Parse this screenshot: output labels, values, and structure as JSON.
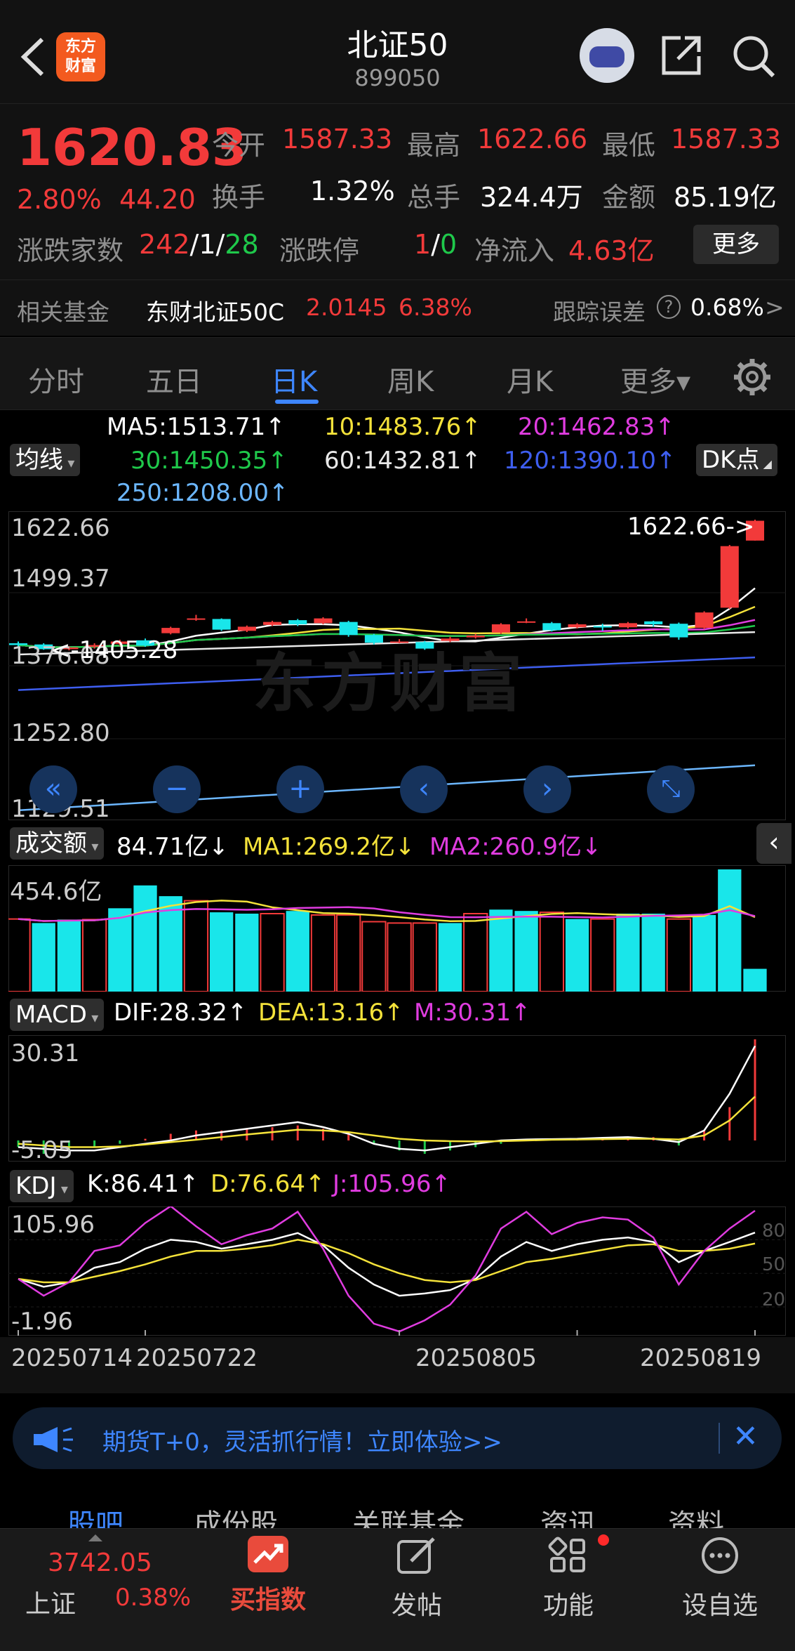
{
  "header": {
    "title": "北证50",
    "code": "899050",
    "logo_lines": [
      "东方",
      "财富"
    ]
  },
  "quote": {
    "price": "1620.83",
    "change_pct": "2.80%",
    "change": "44.20",
    "open_label": "今开",
    "open": "1587.33",
    "high_label": "最高",
    "high": "1622.66",
    "low_label": "最低",
    "low": "1587.33",
    "turnover_label": "换手",
    "turnover": "1.32%",
    "volume_label": "总手",
    "volume": "324.4万",
    "amount_label": "金额",
    "amount": "85.19亿",
    "breadth_label": "涨跌家数",
    "breadth_up": "242",
    "breadth_sep1": "/",
    "breadth_flat": "1",
    "breadth_sep2": "/",
    "breadth_down": "28",
    "limit_label": "涨跌停",
    "limit_up": "1",
    "limit_sep": "/",
    "limit_down": "0",
    "netflow_label": "净流入",
    "netflow": "4.63亿",
    "more_label": "更多"
  },
  "fund": {
    "label": "相关基金",
    "name": "东财北证50C",
    "nav": "2.0145",
    "pct": "6.38%",
    "tracking_label": "跟踪误差",
    "tracking": "0.68%",
    "help_icon": "?",
    "arrow": ">"
  },
  "tabs": [
    "分时",
    "五日",
    "日K",
    "周K",
    "月K",
    "更多▾"
  ],
  "active_tab": 2,
  "ma_legend": {
    "chip": "均线",
    "ma5": "MA5:1513.71↑",
    "ma10": "10:1483.76↑",
    "ma20": "20:1462.83↑",
    "ma30": "30:1450.35↑",
    "ma60": "60:1432.81↑",
    "ma120": "120:1390.10↑",
    "ma250": "250:1208.00↑",
    "dk_chip": "DK点"
  },
  "price_axis": [
    "1622.66",
    "1499.37",
    "1376.08",
    "1252.80",
    "1129.51"
  ],
  "high_marker": "1622.66->",
  "low_marker": "<-1405.28",
  "watermark": "东方财富",
  "volume_legend": {
    "chip": "成交额",
    "value": "84.71亿↓",
    "ma1": "MA1:269.2亿↓",
    "ma2": "MA2:260.9亿↓",
    "axis": "454.6亿"
  },
  "macd_legend": {
    "chip": "MACD",
    "dif": "DIF:28.32↑",
    "dea": "DEA:13.16↑",
    "m": "M:30.31↑",
    "axis_top": "30.31",
    "axis_bottom": "-5.05"
  },
  "kdj_legend": {
    "chip": "KDJ",
    "k": "K:86.41↑",
    "d": "D:76.64↑",
    "j": "J:105.96↑",
    "axis_top": "105.96",
    "axis_bottom": "-1.96",
    "levels": [
      "80",
      "50",
      "20"
    ]
  },
  "dates": [
    "20250714",
    "20250722",
    "20250805",
    "20250819"
  ],
  "chart_data": {
    "type": "candlestick",
    "candles": [
      {
        "o": 1414,
        "c": 1411,
        "h": 1417,
        "l": 1408
      },
      {
        "o": 1412,
        "c": 1404,
        "h": 1414,
        "l": 1403
      },
      {
        "o": 1404,
        "c": 1407,
        "h": 1409,
        "l": 1402
      },
      {
        "o": 1408,
        "c": 1411,
        "h": 1414,
        "l": 1405
      },
      {
        "o": 1413,
        "c": 1417,
        "h": 1420,
        "l": 1410
      },
      {
        "o": 1419,
        "c": 1410,
        "h": 1422,
        "l": 1408
      },
      {
        "o": 1431,
        "c": 1440,
        "h": 1442,
        "l": 1429
      },
      {
        "o": 1455,
        "c": 1456,
        "h": 1462,
        "l": 1452
      },
      {
        "o": 1455,
        "c": 1437,
        "h": 1456,
        "l": 1435
      },
      {
        "o": 1435,
        "c": 1442,
        "h": 1444,
        "l": 1433
      },
      {
        "o": 1445,
        "c": 1450,
        "h": 1452,
        "l": 1443
      },
      {
        "o": 1453,
        "c": 1446,
        "h": 1455,
        "l": 1443
      },
      {
        "o": 1448,
        "c": 1456,
        "h": 1458,
        "l": 1446
      },
      {
        "o": 1450,
        "c": 1428,
        "h": 1452,
        "l": 1425
      },
      {
        "o": 1428,
        "c": 1415,
        "h": 1430,
        "l": 1412
      },
      {
        "o": 1417,
        "c": 1417,
        "h": 1421,
        "l": 1414
      },
      {
        "o": 1416,
        "c": 1405,
        "h": 1418,
        "l": 1403
      },
      {
        "o": 1418,
        "c": 1422,
        "h": 1425,
        "l": 1416
      },
      {
        "o": 1424,
        "c": 1427,
        "h": 1430,
        "l": 1422
      },
      {
        "o": 1432,
        "c": 1446,
        "h": 1448,
        "l": 1430
      },
      {
        "o": 1450,
        "c": 1451,
        "h": 1456,
        "l": 1448
      },
      {
        "o": 1448,
        "c": 1436,
        "h": 1450,
        "l": 1434
      },
      {
        "o": 1441,
        "c": 1446,
        "h": 1448,
        "l": 1439
      },
      {
        "o": 1443,
        "c": 1441,
        "h": 1447,
        "l": 1435
      },
      {
        "o": 1441,
        "c": 1448,
        "h": 1450,
        "l": 1439
      },
      {
        "o": 1451,
        "c": 1446,
        "h": 1452,
        "l": 1442
      },
      {
        "o": 1447,
        "c": 1424,
        "h": 1449,
        "l": 1420
      },
      {
        "o": 1440,
        "c": 1466,
        "h": 1468,
        "l": 1438
      },
      {
        "o": 1474,
        "c": 1578,
        "h": 1580,
        "l": 1472
      },
      {
        "o": 1587.33,
        "c": 1620.83,
        "h": 1622.66,
        "l": 1587.33
      }
    ],
    "volume_up": [
      false,
      true,
      true,
      false,
      true,
      true,
      true,
      false,
      true,
      true,
      false,
      true,
      false,
      false,
      false,
      false,
      false,
      true,
      false,
      true,
      true,
      false,
      true,
      false,
      true,
      true,
      false,
      true,
      true,
      true
    ],
    "volumes": [
      270,
      255,
      268,
      268,
      310,
      395,
      355,
      338,
      295,
      290,
      290,
      300,
      285,
      285,
      260,
      255,
      255,
      255,
      290,
      305,
      300,
      295,
      270,
      270,
      290,
      290,
      270,
      285,
      454.6,
      84.71
    ],
    "macd_hist": [
      -2,
      -4,
      -3,
      -2,
      -1,
      0.5,
      2,
      3,
      3,
      3.5,
      4,
      4.5,
      3.5,
      2.5,
      -1,
      -3,
      -4,
      -3,
      -2,
      -1,
      0.3,
      0.5,
      0.5,
      0.6,
      0.7,
      1,
      -1.5,
      3,
      10,
      30.31
    ],
    "k": [
      45,
      38,
      42,
      55,
      60,
      72,
      80,
      78,
      72,
      76,
      80,
      86,
      75,
      55,
      40,
      30,
      32,
      35,
      45,
      65,
      78,
      70,
      76,
      80,
      82,
      78,
      60,
      70,
      78,
      86.41
    ],
    "d": [
      45,
      42,
      42,
      47,
      52,
      58,
      65,
      70,
      70,
      72,
      75,
      80,
      76,
      68,
      58,
      50,
      44,
      42,
      44,
      52,
      60,
      63,
      67,
      71,
      75,
      76,
      70,
      70,
      72,
      76.64
    ],
    "j": [
      45,
      30,
      42,
      70,
      75,
      95,
      110,
      92,
      76,
      84,
      90,
      105,
      72,
      30,
      5,
      -1.96,
      8,
      22,
      48,
      90,
      105,
      85,
      95,
      100,
      98,
      82,
      40,
      70,
      90,
      105.96
    ]
  },
  "banner": {
    "text": "期货T+0，灵活抓行情！立即体验>>"
  },
  "subtabs": [
    "股吧",
    "成份股",
    "关联基金",
    "资讯",
    "资料"
  ],
  "bottom_nav": {
    "index_value": "3742.05",
    "index_name": "上证",
    "index_pct": "0.38%",
    "buy_label": "买指数",
    "post_label": "发帖",
    "func_label": "功能",
    "watch_label": "设自选"
  }
}
